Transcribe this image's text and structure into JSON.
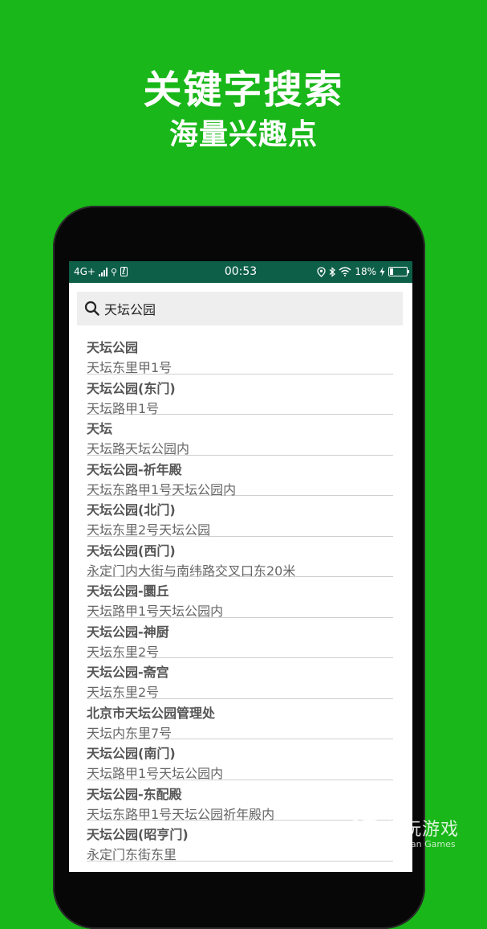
{
  "promo": {
    "title": "关键字搜索",
    "subtitle": "海量兴趣点"
  },
  "status_bar": {
    "network": "4G+",
    "time": "00:53",
    "battery": "18%",
    "battery_level": 0.18,
    "icons": [
      "signal-icon",
      "usb-icon",
      "app-notification-icon",
      "location-icon",
      "bluetooth-icon",
      "wifi-icon",
      "charging-icon",
      "battery-icon"
    ]
  },
  "search": {
    "query": "天坛公园",
    "icon": "search-icon"
  },
  "results": [
    {
      "name": "天坛公园",
      "address": "天坛东里甲1号"
    },
    {
      "name": "天坛公园(东门)",
      "address": "天坛路甲1号"
    },
    {
      "name": "天坛",
      "address": "天坛路天坛公园内"
    },
    {
      "name": "天坛公园-祈年殿",
      "address": "天坛东路甲1号天坛公园内"
    },
    {
      "name": "天坛公园(北门)",
      "address": "天坛东里2号天坛公园"
    },
    {
      "name": "天坛公园(西门)",
      "address": "永定门内大街与南纬路交叉口东20米"
    },
    {
      "name": "天坛公园-圜丘",
      "address": "天坛路甲1号天坛公园内"
    },
    {
      "name": "天坛公园-神厨",
      "address": "天坛东里2号"
    },
    {
      "name": "天坛公园-斋宫",
      "address": "天坛东里2号"
    },
    {
      "name": "北京市天坛公园管理处",
      "address": "天坛内东里7号"
    },
    {
      "name": "天坛公园(南门)",
      "address": "天坛路甲1号天坛公园内"
    },
    {
      "name": "天坛公园-东配殿",
      "address": "天坛东路甲1号天坛公园祈年殿内"
    },
    {
      "name": "天坛公园(昭亨门)",
      "address": "永定门东街东里"
    }
  ],
  "watermark": {
    "name": "仍玩游戏",
    "subtitle": "Renwan Games"
  },
  "colors": {
    "background": "#19b719",
    "status_bar": "#0e5f47",
    "search_box": "#eeeeee"
  }
}
